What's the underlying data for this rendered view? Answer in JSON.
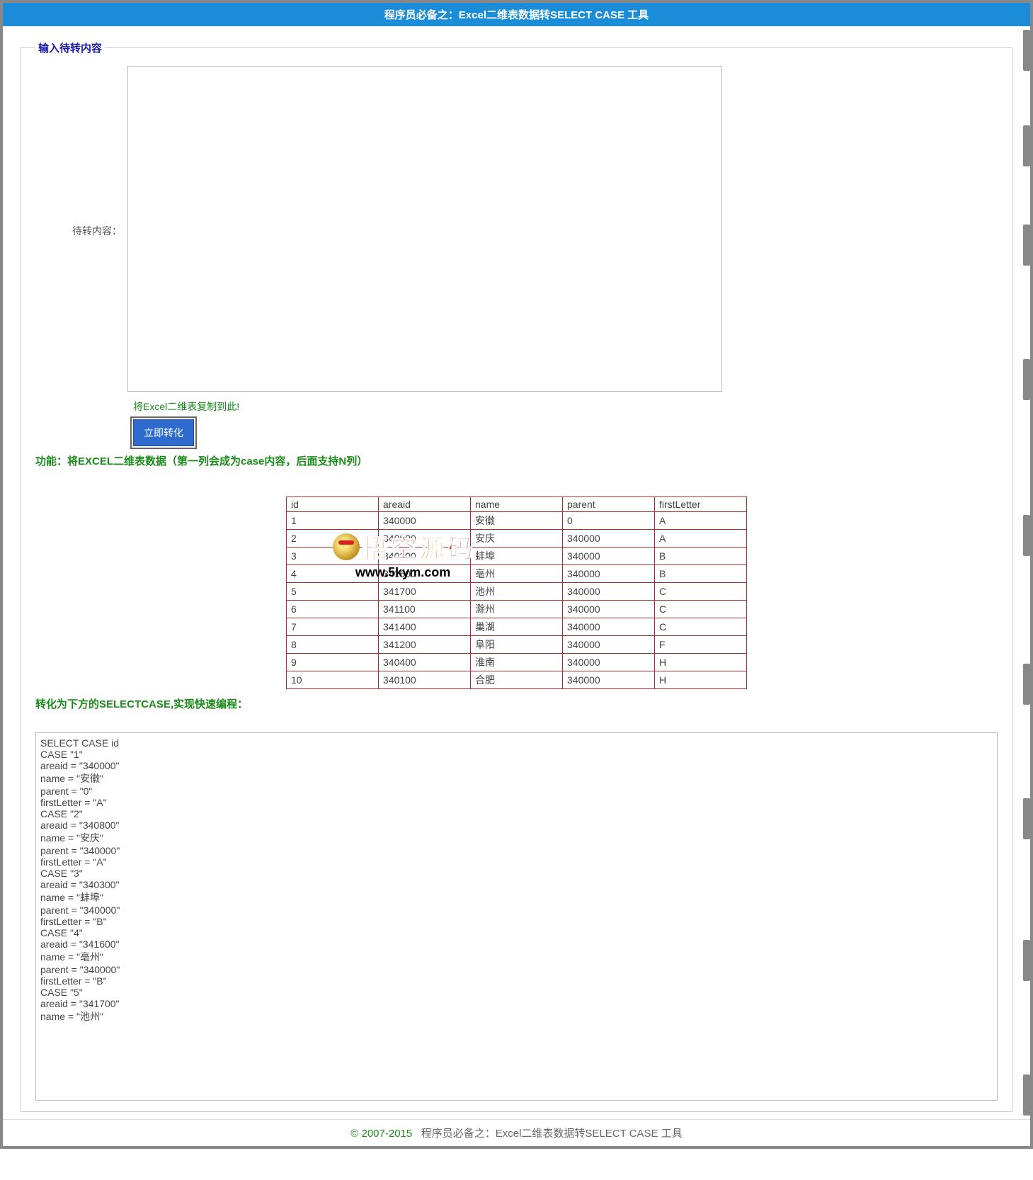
{
  "header": {
    "title": "程序员必备之：Excel二维表数据转SELECT CASE 工具"
  },
  "fieldset": {
    "legend": "输入待转内容",
    "input_label": "待转内容：",
    "hint": "将Excel二维表复制到此!",
    "button_label": "立即转化"
  },
  "description1": "功能：将EXCEL二维表数据（第一列会成为case内容，后面支持N列）",
  "table": {
    "rows": [
      [
        "id",
        "areaid",
        "name",
        "parent",
        "firstLetter"
      ],
      [
        "1",
        "340000",
        "安徽",
        "0",
        "A"
      ],
      [
        "2",
        "340800",
        "安庆",
        "340000",
        "A"
      ],
      [
        "3",
        "340300",
        "蚌埠",
        "340000",
        "B"
      ],
      [
        "4",
        "341600",
        "亳州",
        "340000",
        "B"
      ],
      [
        "5",
        "341700",
        "池州",
        "340000",
        "C"
      ],
      [
        "6",
        "341100",
        "滁州",
        "340000",
        "C"
      ],
      [
        "7",
        "341400",
        "巢湖",
        "340000",
        "C"
      ],
      [
        "8",
        "341200",
        "阜阳",
        "340000",
        "F"
      ],
      [
        "9",
        "340400",
        "淮南",
        "340000",
        "H"
      ],
      [
        "10",
        "340100",
        "合肥",
        "340000",
        "H"
      ]
    ]
  },
  "description2": "转化为下方的SELECTCASE,实现快速编程：",
  "output_text": "SELECT CASE id\nCASE \"1\"\nareaid = \"340000\"\nname = \"安徽\"\nparent = \"0\"\nfirstLetter = \"A\"\nCASE \"2\"\nareaid = \"340800\"\nname = \"安庆\"\nparent = \"340000\"\nfirstLetter = \"A\"\nCASE \"3\"\nareaid = \"340300\"\nname = \"蚌埠\"\nparent = \"340000\"\nfirstLetter = \"B\"\nCASE \"4\"\nareaid = \"341600\"\nname = \"亳州\"\nparent = \"340000\"\nfirstLetter = \"B\"\nCASE \"5\"\nareaid = \"341700\"\nname = \"池州\"",
  "footer": {
    "year": "© 2007-2015",
    "text": "程序员必备之：Excel二维表数据转SELECT CASE 工具"
  },
  "watermark": {
    "t1": "悟",
    "t2": "空",
    "t3": "源",
    "t4": "码",
    "link": "www.5kym.com"
  }
}
